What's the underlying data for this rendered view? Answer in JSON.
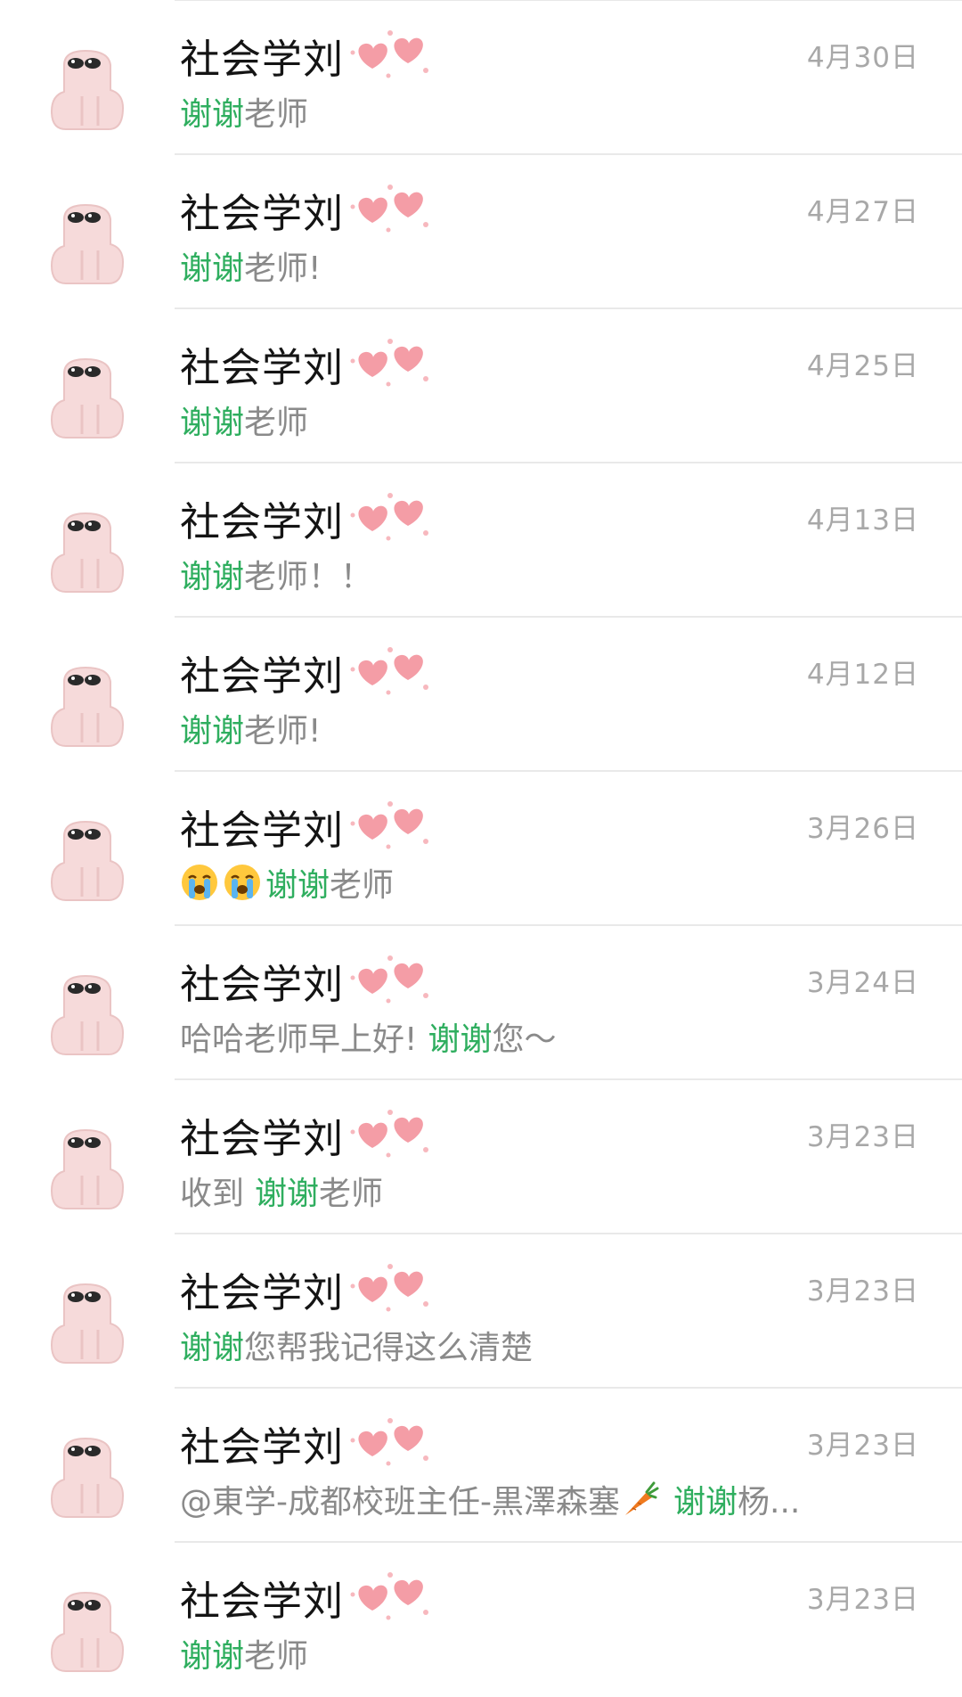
{
  "chat_list": {
    "rows": [
      {
        "name": "社会学刘",
        "date": "4月30日",
        "message": {
          "highlight": "谢谢",
          "after": "老师"
        }
      },
      {
        "name": "社会学刘",
        "date": "4月27日",
        "message": {
          "highlight": "谢谢",
          "after": "老师!"
        }
      },
      {
        "name": "社会学刘",
        "date": "4月25日",
        "message": {
          "highlight": "谢谢",
          "after": "老师"
        }
      },
      {
        "name": "社会学刘",
        "date": "4月13日",
        "message": {
          "highlight": "谢谢",
          "after": "老师！！"
        }
      },
      {
        "name": "社会学刘",
        "date": "4月12日",
        "message": {
          "highlight": "谢谢",
          "after": "老师!"
        }
      },
      {
        "name": "社会学刘",
        "date": "3月26日",
        "message": {
          "emoji": "crying-emoji",
          "highlight": "谢谢",
          "after": "老师"
        }
      },
      {
        "name": "社会学刘",
        "date": "3月24日",
        "message": {
          "before": "哈哈老师早上好!",
          "highlight": "谢谢",
          "after": "您～"
        }
      },
      {
        "name": "社会学刘",
        "date": "3月23日",
        "message": {
          "before": "收到",
          "highlight": "谢谢",
          "after": "老师"
        }
      },
      {
        "name": "社会学刘",
        "date": "3月23日",
        "message": {
          "highlight": "谢谢",
          "after": "您帮我记得这么清楚"
        }
      },
      {
        "name": "社会学刘",
        "date": "3月23日",
        "message": {
          "before": "@東学-成都校班主任-黒澤森塞",
          "emoji": "carrot-emoji",
          "highlight": "谢谢",
          "after": "杨..."
        }
      },
      {
        "name": "社会学刘",
        "date": "3月23日",
        "message": {
          "highlight": "谢谢",
          "after": "老师"
        }
      }
    ]
  },
  "colors": {
    "highlight": "#2fae5f",
    "name": "#141414",
    "date": "#a8a8a8",
    "message": "#8a8a8a",
    "heart": "#f28c96",
    "avatar": "#f4d6d6"
  }
}
